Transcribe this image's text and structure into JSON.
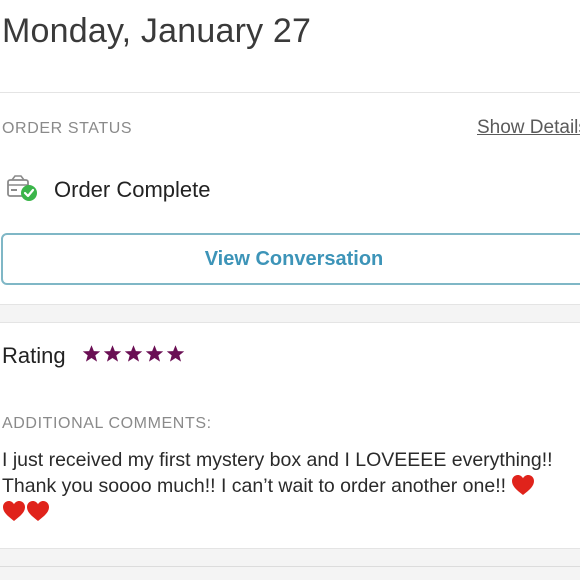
{
  "header": {
    "date": "Monday, January 27"
  },
  "order_status": {
    "label": "ORDER STATUS",
    "show_details": "Show Details",
    "status": "Order Complete",
    "view_conversation": "View Conversation"
  },
  "rating": {
    "label": "Rating",
    "stars": 5,
    "star_color": "#6a0f54"
  },
  "comments": {
    "label": "ADDITIONAL COMMENTS:",
    "line1": "I just received my first mystery box and I LOVEEEE everything!!",
    "line2": "Thank you soooo much!! I can’t wait to order another one!!",
    "hearts_icon": "red-heart-emoji"
  },
  "colors": {
    "accent": "#3d94b8",
    "button_border": "#7fb7c6",
    "success_green": "#3bb54a"
  }
}
